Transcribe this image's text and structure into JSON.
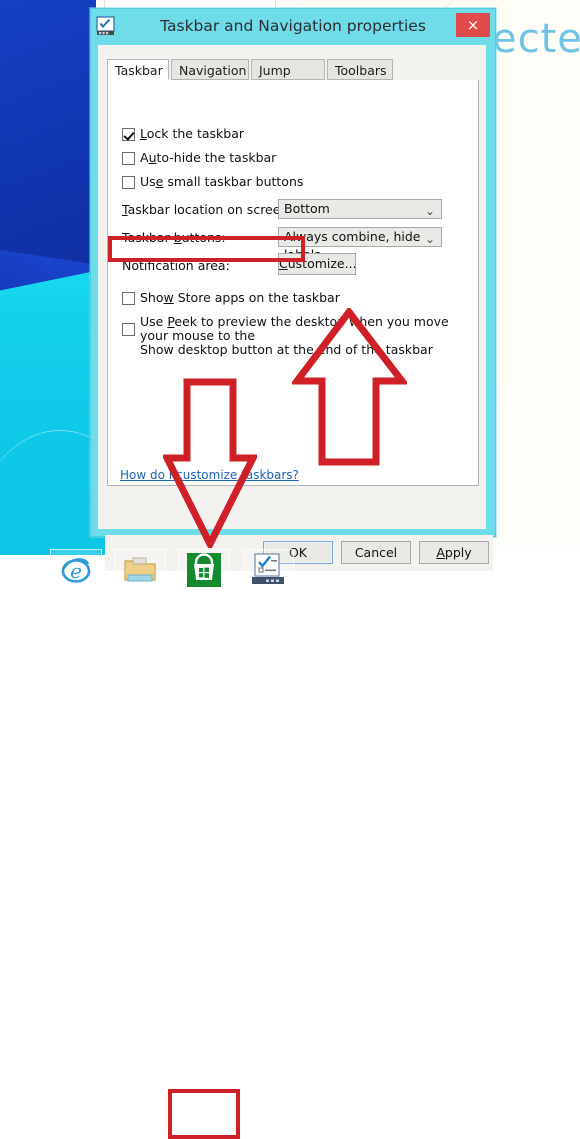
{
  "background": {
    "text_fragment": "ecte",
    "back_button_icon": "chevron-left-icon"
  },
  "dialog": {
    "title": "Taskbar and Navigation properties",
    "title_icon": "taskbar-properties-icon",
    "close_label": "×",
    "tabs": [
      {
        "label": "Taskbar",
        "selected": true
      },
      {
        "label": "Navigation",
        "selected": false
      },
      {
        "label": "Jump Lists",
        "selected": false
      },
      {
        "label": "Toolbars",
        "selected": false
      }
    ],
    "checkboxes": [
      {
        "label": "Lock the taskbar",
        "accel": "L",
        "checked": true
      },
      {
        "label": "Auto-hide the taskbar",
        "accel": "u",
        "checked": false
      },
      {
        "label": "Use small taskbar buttons",
        "accel": "e",
        "checked": false
      }
    ],
    "fields": [
      {
        "label": "Taskbar location on screen:",
        "accel": "T",
        "value": "Bottom"
      },
      {
        "label": "Taskbar buttons:",
        "accel": "b",
        "value": "Always combine, hide labels"
      },
      {
        "label": "Notification area:",
        "accel": "",
        "button": "Customize...",
        "button_accel": "C"
      }
    ],
    "store_option": {
      "label": "Show Store apps on the taskbar",
      "accel": "w",
      "checked": false,
      "highlighted": true
    },
    "peek_option": {
      "line1": "Use Peek to preview the desktop when you move your mouse to the",
      "line2": "Show desktop button at the end of the taskbar",
      "accel": "P",
      "checked": false
    },
    "help_link": "How do I customize taskbars?",
    "buttons": [
      {
        "label": "OK",
        "default": true
      },
      {
        "label": "Cancel",
        "default": false
      },
      {
        "label": "Apply",
        "accel": "A",
        "default": false
      }
    ]
  },
  "annotations": {
    "highlight_color": "#cf2027",
    "up_arrow": "red-up-arrow-annotation",
    "down_arrow": "red-down-arrow-annotation",
    "store_checkbox_box": "red-rectangle-annotation",
    "store_taskbar_box": "red-rectangle-annotation"
  },
  "taskbar": {
    "items": [
      {
        "name": "start-button",
        "icon": "windows-logo-icon"
      },
      {
        "name": "internet-explorer-button",
        "icon": "internet-explorer-icon"
      },
      {
        "name": "file-explorer-button",
        "icon": "folder-icon"
      },
      {
        "name": "store-button",
        "icon": "store-bag-icon"
      },
      {
        "name": "taskbar-properties-button",
        "icon": "taskbar-properties-icon"
      }
    ]
  }
}
